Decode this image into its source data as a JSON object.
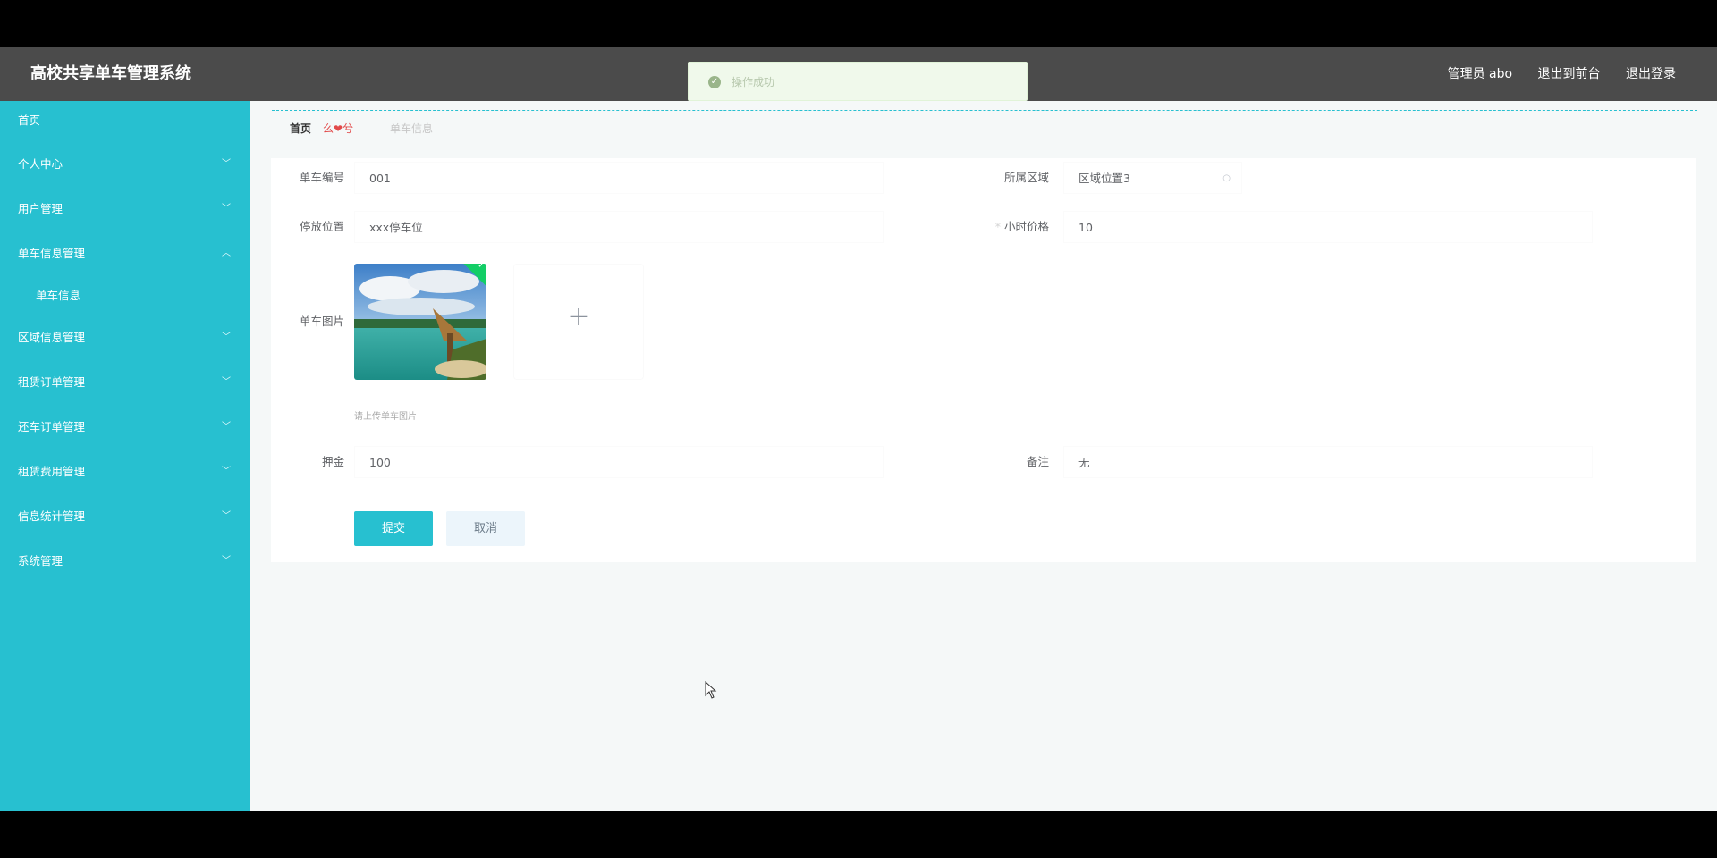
{
  "header": {
    "brand": "高校共享单车管理系统",
    "admin_label": "管理员 abo",
    "to_front_label": "退出到前台",
    "logout_label": "退出登录"
  },
  "toast": {
    "message": "操作成功"
  },
  "sidebar": {
    "items": [
      {
        "label": "首页"
      },
      {
        "label": "个人中心"
      },
      {
        "label": "用户管理"
      },
      {
        "label": "单车信息管理"
      },
      {
        "label": "单车信息"
      },
      {
        "label": "区域信息管理"
      },
      {
        "label": "租赁订单管理"
      },
      {
        "label": "还车订单管理"
      },
      {
        "label": "租赁费用管理"
      },
      {
        "label": "信息统计管理"
      },
      {
        "label": "系统管理"
      }
    ]
  },
  "breadcrumb": {
    "home": "首页",
    "current": "单车信息"
  },
  "form": {
    "bike_no_label": "单车编号",
    "bike_no_value": "001",
    "area_label": "所属区域",
    "area_value": "区域位置3",
    "park_label": "停放位置",
    "park_value": "xxx停车位",
    "price_label": "小时价格",
    "price_value": "10",
    "image_label": "单车图片",
    "image_hint": "请上传单车图片",
    "deposit_label": "押金",
    "deposit_value": "100",
    "remark_label": "备注",
    "remark_value": "无",
    "submit_label": "提交",
    "cancel_label": "取消"
  }
}
